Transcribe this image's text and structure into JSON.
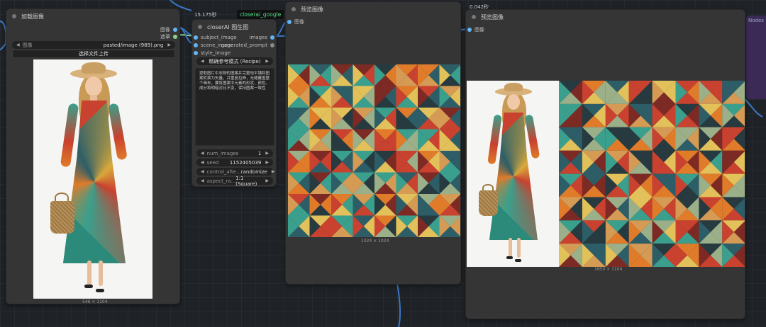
{
  "canvas": {
    "timer_top": "15.175秒",
    "timer_right": "0.042秒",
    "badge": "closerai_google",
    "right_edge_label": "Nodes"
  },
  "load_node": {
    "title": "加载图像",
    "outputs": [
      "图像",
      "遮罩"
    ],
    "image_widget_label": "图像",
    "image_widget_value": "pasted/image (989).png",
    "upload_button": "选择文件上传",
    "size": "546 × 1104"
  },
  "closer_node": {
    "title": "closerAI 图生图",
    "inputs": [
      "subject_image",
      "scene_image",
      "style_image"
    ],
    "outputs": [
      "images",
      "generated_prompt"
    ],
    "mode_value": "精确参考模式 (Recipe)",
    "prompt_text": "提取图片中衣物的图案并完整地平铺到图案转换为矢量，并重复拉伸，无缝覆盖整个画布，要将图案中元素的形状、颜色、成分和明暗对比不变，保持图案一致性",
    "widgets": [
      {
        "label": "num_images",
        "value": "1"
      },
      {
        "label": "seed",
        "value": "1152405039"
      },
      {
        "label": "control_afte...",
        "value": "randomize"
      },
      {
        "label": "aspect_ra...",
        "value": "1:1 (Square)"
      }
    ]
  },
  "preview1": {
    "title": "预览图像",
    "input": "图像",
    "size": "1024 × 1024"
  },
  "preview2": {
    "title": "预览图像",
    "input": "图像",
    "size": "1650 × 1104"
  },
  "colors": {
    "socket_blue": "#64b5f6",
    "socket_green": "#8fd18f",
    "node_bg": "#353535",
    "wire": "#3a78c4",
    "badge_accent": "#4fe08a"
  },
  "pattern_palette": [
    "#c9412f",
    "#e07b2a",
    "#e3c15a",
    "#2d5e68",
    "#3a9f8c",
    "#7d2a24",
    "#263a3f",
    "#9bb089",
    "#d59a54"
  ]
}
